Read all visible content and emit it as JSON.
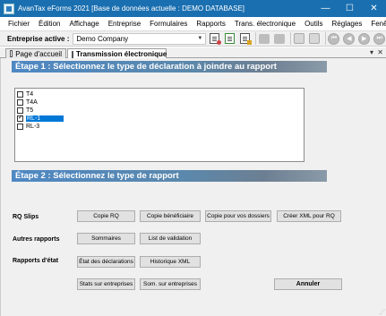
{
  "window": {
    "title": "AvanTax eForms 2021 [Base de données actuelle : DEMO DATABASE]",
    "minimize": "—",
    "maximize": "☐",
    "close": "✕"
  },
  "menu": [
    "Fichier",
    "Édition",
    "Affichage",
    "Entreprise",
    "Formulaires",
    "Rapports",
    "Trans. électronique",
    "Outils",
    "Réglages",
    "Fenêtre"
  ],
  "toolbar": {
    "company_label": "Entreprise active :",
    "company_value": "Demo Company",
    "icons": [
      "report-preview-icon",
      "report-add-icon",
      "report-edit-icon",
      "printer-icon",
      "copy-icon",
      "lock-icon",
      "lock-alt-icon",
      "first-record-icon",
      "previous-record-icon",
      "next-record-icon",
      "last-record-icon"
    ]
  },
  "tabs": [
    {
      "label": "Page d'accueil",
      "active": false
    },
    {
      "label": "Transmission électronique",
      "active": true
    }
  ],
  "tab_controls": {
    "dropdown": "▾",
    "close": "✕"
  },
  "step1": {
    "title": "Étape 1 : Sélectionnez le type de déclaration à joindre au rapport",
    "items": [
      {
        "label": "T4",
        "checked": false,
        "selected": false
      },
      {
        "label": "T4A",
        "checked": false,
        "selected": false
      },
      {
        "label": "T5",
        "checked": false,
        "selected": false
      },
      {
        "label": "RL-1",
        "checked": true,
        "selected": true
      },
      {
        "label": "RL-3",
        "checked": false,
        "selected": false
      }
    ]
  },
  "step2": {
    "title": "Étape 2 : Sélectionnez le type de rapport",
    "rows": [
      {
        "label": "RQ Slips",
        "buttons": [
          "Copie RQ",
          "Copie bénéficiaire",
          "Copie pour vos dossiers",
          "Créer XML pour RQ"
        ]
      },
      {
        "label": "Autres rapports",
        "buttons": [
          "Sommaires",
          "List de validation"
        ]
      },
      {
        "label": "Rapports d'état",
        "buttons": [
          "État des déclarations",
          "Historique XML"
        ]
      },
      {
        "label": "",
        "buttons": [
          "Stats sur entreprises",
          "Som. sur entreprises"
        ]
      }
    ],
    "cancel": "Annuler"
  },
  "colors": {
    "titlebar": "#1a6fb0",
    "selection": "#0078d7",
    "banner_start": "#4e88c4",
    "banner_end": "#8a9aa8"
  }
}
